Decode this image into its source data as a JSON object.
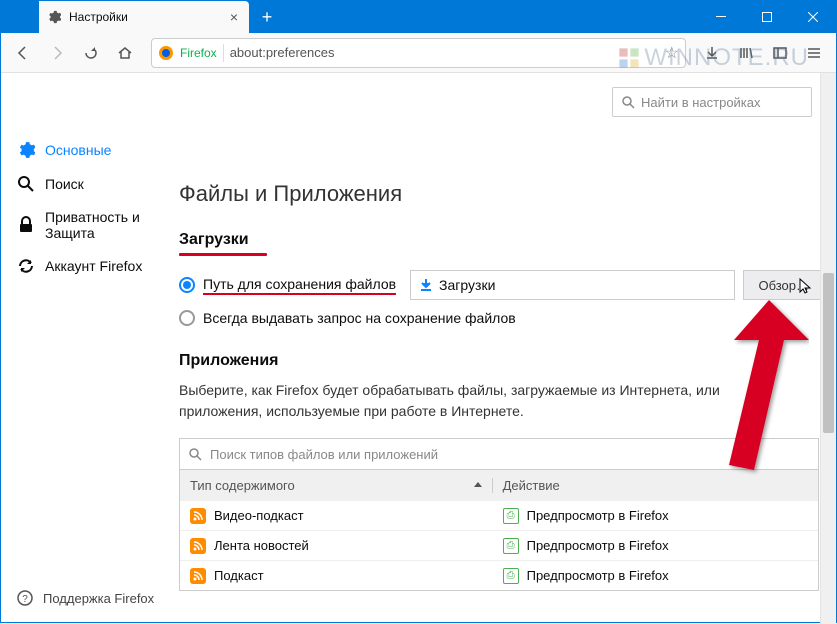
{
  "window": {
    "tab_title": "Настройки",
    "url_tag": "Firefox",
    "url": "about:preferences"
  },
  "watermark": "WINNOTE.RU",
  "search_prefs_placeholder": "Найти в настройках",
  "sidebar": {
    "items": [
      {
        "label": "Основные"
      },
      {
        "label": "Поиск"
      },
      {
        "label": "Приватность и Защита"
      },
      {
        "label": "Аккаунт Firefox"
      }
    ],
    "support": "Поддержка Firefox"
  },
  "main": {
    "section_title": "Файлы и Приложения",
    "downloads": {
      "heading": "Загрузки",
      "save_to_label": "Путь для сохранения файлов",
      "folder": "Загрузки",
      "browse": "Обзор…",
      "always_ask": "Всегда выдавать запрос на сохранение файлов"
    },
    "apps": {
      "heading": "Приложения",
      "desc": "Выберите, как Firefox будет обрабатывать файлы, загружаемые из Интернета, или приложения, используемые при работе в Интернете.",
      "search_placeholder": "Поиск типов файлов или приложений",
      "col_type": "Тип содержимого",
      "col_action": "Действие",
      "rows": [
        {
          "type": "Видео-подкаст",
          "action": "Предпросмотр в Firefox"
        },
        {
          "type": "Лента новостей",
          "action": "Предпросмотр в Firefox"
        },
        {
          "type": "Подкаст",
          "action": "Предпросмотр в Firefox"
        }
      ]
    }
  }
}
